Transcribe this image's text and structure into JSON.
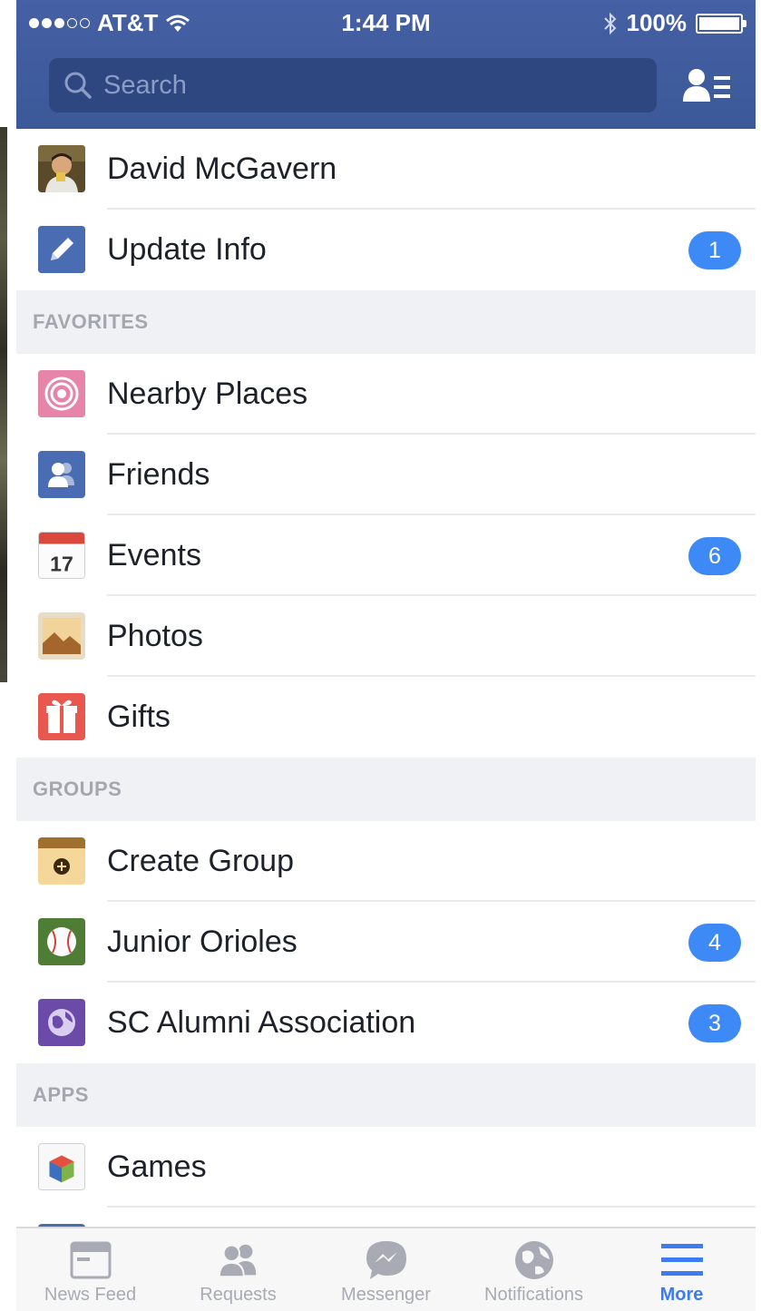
{
  "status_bar": {
    "carrier": "AT&T",
    "time": "1:44 PM",
    "battery": "100%"
  },
  "search": {
    "placeholder": "Search"
  },
  "profile": {
    "name": "David McGavern"
  },
  "update_info": {
    "label": "Update Info",
    "badge": "1"
  },
  "sections": {
    "favorites": "FAVORITES",
    "groups": "GROUPS",
    "apps": "APPS"
  },
  "favorites": [
    {
      "label": "Nearby Places",
      "icon": "nearby-places-icon",
      "badge": ""
    },
    {
      "label": "Friends",
      "icon": "friends-icon",
      "badge": ""
    },
    {
      "label": "Events",
      "icon": "calendar-icon",
      "badge": "6",
      "icon_text": "17"
    },
    {
      "label": "Photos",
      "icon": "photos-icon",
      "badge": ""
    },
    {
      "label": "Gifts",
      "icon": "gift-icon",
      "badge": ""
    }
  ],
  "groups": [
    {
      "label": "Create Group",
      "icon": "create-group-icon",
      "badge": ""
    },
    {
      "label": "Junior Orioles",
      "icon": "baseball-icon",
      "badge": "4"
    },
    {
      "label": "SC Alumni Association",
      "icon": "globe-group-icon",
      "badge": "3"
    }
  ],
  "apps": [
    {
      "label": "Games",
      "icon": "games-icon",
      "badge": ""
    }
  ],
  "tabs": [
    {
      "label": "News Feed",
      "icon": "news-feed-icon",
      "active": false
    },
    {
      "label": "Requests",
      "icon": "requests-icon",
      "active": false
    },
    {
      "label": "Messenger",
      "icon": "messenger-icon",
      "active": false
    },
    {
      "label": "Notifications",
      "icon": "notifications-icon",
      "active": false
    },
    {
      "label": "More",
      "icon": "more-menu-icon",
      "active": true
    }
  ],
  "colors": {
    "header": "#3b5998",
    "badge": "#3d8af7",
    "active_tab": "#3d7cf0"
  }
}
